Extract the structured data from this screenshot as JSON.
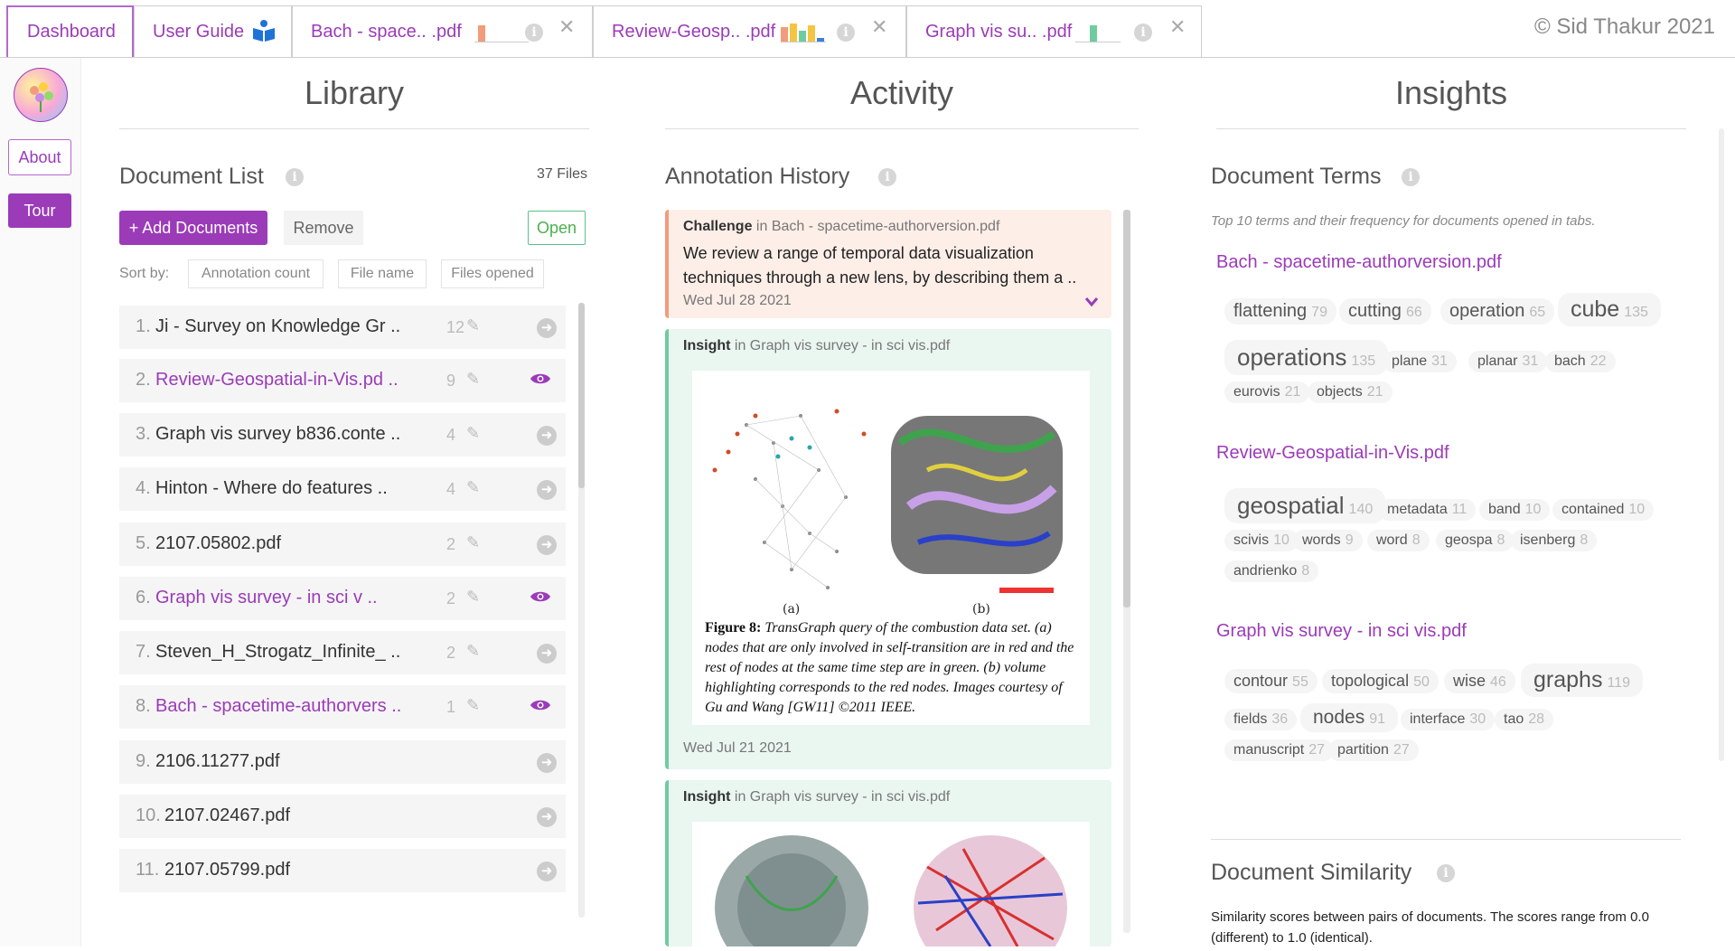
{
  "tabs": [
    {
      "label": "Dashboard"
    },
    {
      "label": "User Guide"
    },
    {
      "label": "Bach - space.. .pdf"
    },
    {
      "label": "Review-Geosp.. .pdf"
    },
    {
      "label": "Graph vis su.. .pdf"
    }
  ],
  "copyright": "© Sid Thakur 2021",
  "sidebar": {
    "about": "About",
    "tour": "Tour"
  },
  "columns": {
    "library": "Library",
    "activity": "Activity",
    "insights": "Insights"
  },
  "library": {
    "section_title": "Document List",
    "files_count": "37 Files",
    "add_button": "+ Add Documents",
    "remove_button": "Remove",
    "open_button": "Open",
    "sort_label": "Sort by:",
    "sort_options": [
      "Annotation count",
      "File name",
      "Files opened"
    ],
    "documents": [
      {
        "num": "1.",
        "name": "Ji - Survey on Knowledge Gr ..",
        "count": "12",
        "opened": false
      },
      {
        "num": "2.",
        "name": "Review-Geospatial-in-Vis.pd ..",
        "count": "9",
        "opened": true
      },
      {
        "num": "3.",
        "name": "Graph vis survey b836.conte ..",
        "count": "4",
        "opened": false
      },
      {
        "num": "4.",
        "name": "Hinton - Where do features ..",
        "count": "4",
        "opened": false
      },
      {
        "num": "5.",
        "name": "2107.05802.pdf",
        "count": "2",
        "opened": false
      },
      {
        "num": "6.",
        "name": "Graph vis survey - in sci v ..",
        "count": "2",
        "opened": true
      },
      {
        "num": "7.",
        "name": "Steven_H_Strogatz_Infinite_ ..",
        "count": "2",
        "opened": false
      },
      {
        "num": "8.",
        "name": "Bach - spacetime-authorvers ..",
        "count": "1",
        "opened": true
      },
      {
        "num": "9.",
        "name": "2106.11277.pdf",
        "count": "",
        "opened": false
      },
      {
        "num": "10.",
        "name": "2107.02467.pdf",
        "count": "",
        "opened": false
      },
      {
        "num": "11.",
        "name": "2107.05799.pdf",
        "count": "",
        "opened": false
      }
    ]
  },
  "activity": {
    "section_title": "Annotation History",
    "cards": [
      {
        "type": "Challenge",
        "in_word": "in",
        "doc": "Bach - spacetime-authorversion.pdf",
        "text": "We review a range of temporal data visualization techniques through a new lens, by describing them a ..",
        "date": "Wed Jul 28 2021"
      },
      {
        "type": "Insight",
        "in_word": "in",
        "doc": "Graph vis survey - in sci vis.pdf",
        "figure_labels": [
          "(a)",
          "(b)"
        ],
        "caption_bold": "Figure 8:",
        "caption": "TransGraph query of the combustion data set. (a) nodes that are only involved in self-transition are in red and the rest of nodes at the same time step are in green. (b) volume highlighting corresponds to the red nodes. Images courtesy of Gu and Wang [GW11] ©2011 IEEE.",
        "date": "Wed Jul 21 2021"
      },
      {
        "type": "Insight",
        "in_word": "in",
        "doc": "Graph vis survey - in sci vis.pdf"
      }
    ]
  },
  "insights": {
    "section_title": "Document Terms",
    "description": "Top 10 terms and their frequency for documents opened in tabs.",
    "documents": [
      {
        "name": "Bach - spacetime-authorversion.pdf",
        "terms": [
          {
            "t": "flattening",
            "f": "79"
          },
          {
            "t": "cutting",
            "f": "66"
          },
          {
            "t": "operation",
            "f": "65"
          },
          {
            "t": "cube",
            "f": "135"
          },
          {
            "t": "operations",
            "f": "135"
          },
          {
            "t": "plane",
            "f": "31"
          },
          {
            "t": "planar",
            "f": "31"
          },
          {
            "t": "bach",
            "f": "22"
          },
          {
            "t": "eurovis",
            "f": "21"
          },
          {
            "t": "objects",
            "f": "21"
          }
        ]
      },
      {
        "name": "Review-Geospatial-in-Vis.pdf",
        "terms": [
          {
            "t": "geospatial",
            "f": "140"
          },
          {
            "t": "metadata",
            "f": "11"
          },
          {
            "t": "band",
            "f": "10"
          },
          {
            "t": "contained",
            "f": "10"
          },
          {
            "t": "scivis",
            "f": "10"
          },
          {
            "t": "words",
            "f": "9"
          },
          {
            "t": "word",
            "f": "8"
          },
          {
            "t": "geospa",
            "f": "8"
          },
          {
            "t": "isenberg",
            "f": "8"
          },
          {
            "t": "andrienko",
            "f": "8"
          }
        ]
      },
      {
        "name": "Graph vis survey - in sci vis.pdf",
        "terms": [
          {
            "t": "contour",
            "f": "55"
          },
          {
            "t": "topological",
            "f": "50"
          },
          {
            "t": "wise",
            "f": "46"
          },
          {
            "t": "graphs",
            "f": "119"
          },
          {
            "t": "fields",
            "f": "36"
          },
          {
            "t": "nodes",
            "f": "91"
          },
          {
            "t": "interface",
            "f": "30"
          },
          {
            "t": "tao",
            "f": "28"
          },
          {
            "t": "manuscript",
            "f": "27"
          },
          {
            "t": "partition",
            "f": "27"
          }
        ]
      }
    ],
    "similarity_title": "Document Similarity",
    "similarity_desc": "Similarity scores between pairs of documents. The scores range from 0.0 (different) to 1.0 (identical)."
  },
  "colors": {
    "accent": "#9b3bb8",
    "challenge": "#f29c7c",
    "insight": "#6fcca0",
    "open": "#4caf50"
  }
}
